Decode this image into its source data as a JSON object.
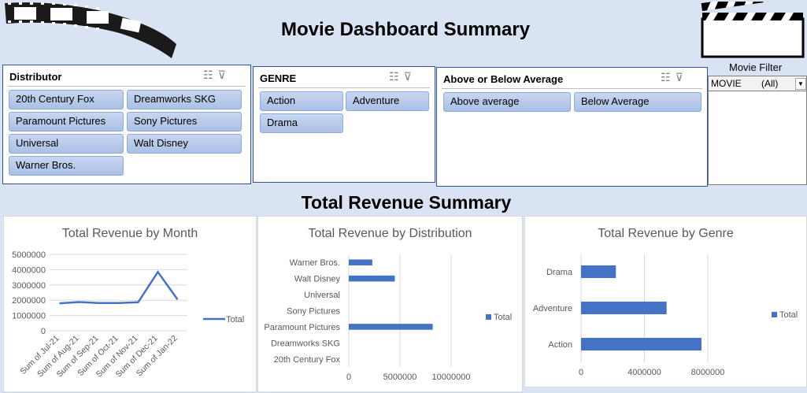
{
  "header": {
    "title": "Movie Dashboard Summary"
  },
  "slicers": {
    "distributor": {
      "title": "Distributor",
      "items": [
        "20th Century Fox",
        "Dreamworks SKG",
        "Paramount Pictures",
        "Sony Pictures",
        "Universal",
        "Walt Disney",
        "Warner Bros."
      ]
    },
    "genre": {
      "title": "GENRE",
      "items": [
        "Action",
        "Adventure",
        "Drama"
      ]
    },
    "average": {
      "title": "Above or Below Average",
      "items": [
        "Above average",
        "Below Average"
      ]
    }
  },
  "movie_filter": {
    "label": "Movie Filter",
    "field": "MOVIE",
    "value": "(All)"
  },
  "section_title": "Total Revenue Summary",
  "colors": {
    "accent": "#4472c4",
    "band": "#dae3f3",
    "border": "#2f5597"
  },
  "chart_data": [
    {
      "type": "line",
      "title": "Total Revenue by Month",
      "categories": [
        "Sum of Jul-21",
        "Sum of Aug-21",
        "Sum of Sep-21",
        "Sum of Oct-21",
        "Sum of Nov-21",
        "Sum of Dec-21",
        "Sum of Jan-22"
      ],
      "series": [
        {
          "name": "Total",
          "values": [
            1800000,
            1880000,
            1820000,
            1820000,
            1870000,
            3850000,
            2050000
          ]
        }
      ],
      "yticks": [
        "5000000",
        "4000000",
        "3000000",
        "2000000",
        "1000000",
        "0"
      ],
      "ylim": [
        0,
        5000000
      ],
      "grid": true,
      "legend": "right"
    },
    {
      "type": "bar",
      "title": "Total Revenue by Distribution",
      "categories": [
        "Warner Bros.",
        "Walt Disney",
        "Universal",
        "Sony Pictures",
        "Paramount Pictures",
        "Dreamworks SKG",
        "20th Century Fox"
      ],
      "series": [
        {
          "name": "Total",
          "values": [
            2300000,
            4500000,
            0,
            0,
            8200000,
            0,
            0
          ]
        }
      ],
      "xticks": [
        "0",
        "5000000",
        "10000000"
      ],
      "xlim": [
        0,
        10000000
      ],
      "grid": true,
      "legend": "right"
    },
    {
      "type": "bar",
      "title": "Total Revenue by Genre",
      "categories": [
        "Drama",
        "Adventure",
        "Action"
      ],
      "series": [
        {
          "name": "Total",
          "values": [
            2200000,
            5400000,
            7600000
          ]
        }
      ],
      "xticks": [
        "0",
        "4000000",
        "8000000"
      ],
      "xlim": [
        0,
        8000000
      ],
      "grid": true,
      "legend": "right"
    }
  ]
}
